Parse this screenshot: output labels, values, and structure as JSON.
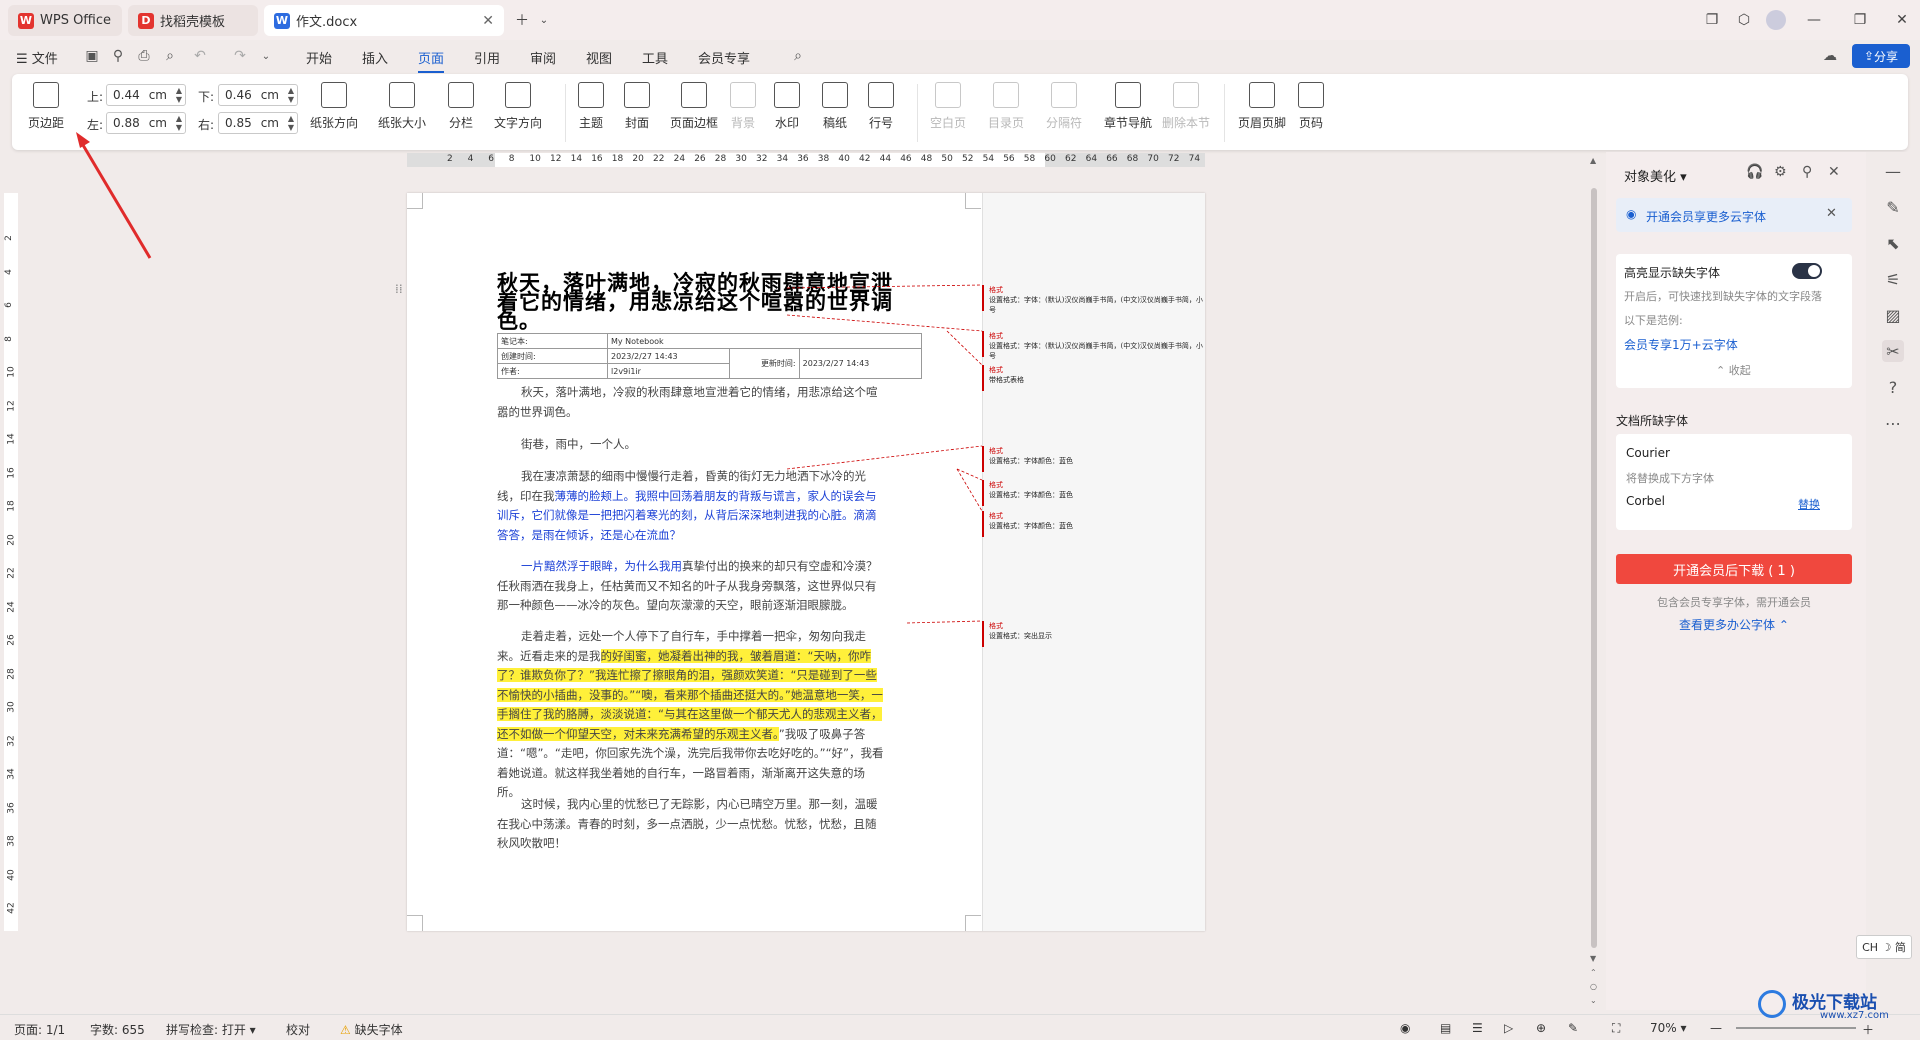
{
  "tabs": [
    {
      "label": "WPS Office",
      "icon": "wps-logo-icon"
    },
    {
      "label": "找稻壳模板",
      "icon": "docer-icon"
    },
    {
      "label": "作文.docx",
      "icon": "word-doc-icon"
    }
  ],
  "menu": {
    "file": "文件",
    "items": [
      "开始",
      "插入",
      "页面",
      "引用",
      "审阅",
      "视图",
      "工具",
      "会员专享"
    ],
    "selected": "页面",
    "share": "分享"
  },
  "ribbon": {
    "margins_label": "页边距",
    "top_label": "上:",
    "top_value": "0.44",
    "bottom_label": "下:",
    "bottom_value": "0.46",
    "left_label": "左:",
    "left_value": "0.88",
    "right_label": "右:",
    "right_value": "0.85",
    "unit": "cm",
    "buttons": [
      "纸张方向",
      "纸张大小",
      "分栏",
      "文字方向",
      "主题",
      "封面",
      "页面边框",
      "背景",
      "水印",
      "稿纸",
      "行号",
      "空白页",
      "目录页",
      "分隔符",
      "章节导航",
      "删除本节",
      "页眉页脚",
      "页码"
    ]
  },
  "ruler": {
    "h_numbers": [
      "2",
      "4",
      "6",
      "8",
      "10",
      "12",
      "14",
      "16",
      "18",
      "20",
      "22",
      "24",
      "26",
      "28",
      "30",
      "32",
      "34",
      "36",
      "38",
      "40",
      "42",
      "44",
      "46",
      "48",
      "50",
      "52",
      "54",
      "56",
      "58",
      "60",
      "62",
      "64",
      "66",
      "68",
      "70",
      "72",
      "74"
    ],
    "v_numbers": [
      "2",
      "4",
      "6",
      "8",
      "10",
      "12",
      "14",
      "16",
      "18",
      "20",
      "22",
      "24",
      "26",
      "28",
      "30",
      "32",
      "34",
      "36",
      "38",
      "40",
      "42"
    ]
  },
  "document": {
    "title": "秋天，落叶满地，冷寂的秋雨肆意地宣泄着它的情绪，用悲凉给这个喧嚣的世界调色。",
    "info": {
      "notebook_label": "笔记本:",
      "notebook_value": "My Notebook",
      "created_label": "创建时间:",
      "created_value": "2023/2/27 14:43",
      "updated_label": "更新时间:",
      "updated_value": "2023/2/27 14:43",
      "author_label": "作者:",
      "author_value": "l2v9i1ir"
    },
    "p1": "秋天，落叶满地，冷寂的秋雨肆意地宣泄着它的情绪，用悲凉给这个喧嚣的世界调色。",
    "p2": "街巷，雨中，一个人。",
    "p3a": "我在凄凉萧瑟的细雨中慢慢行走着，昏黄的街灯无力地洒下冰冷的光线，印在我",
    "p3b": "薄薄的脸颊上。我照中回荡着朋友的背叛与谎言，家人的误会与训斥，它们就像是一把把闪着寒光的刻，从背后深深地刺进我的心脏。滴滴答答，是雨在倾诉，还是心在流血？",
    "p4a": "一片黯然浮于眼眸，为什么我用",
    "p4b": "真挚付出的换来的却只有空虚和冷漠？任秋雨洒在我身上，任枯黄而又不知名的叶子从我身旁飘落，这世界似只有那一种颜色——冰冷的灰色。望向灰濛濛的天空，眼前逐渐泪眼朦胧。",
    "p5a": "走着走着，远处一个人停下了自行车，手中撑着一把伞，匆匆向我走来。近看走来的是我",
    "p5b": "的好闺蜜，她凝着出神的我，皱着眉道：“天呐，你咋了？谁欺负你了？”我连忙擦了擦眼角的泪，强颜欢笑道：“只是碰到了一些不愉快的小插曲，没事的。”“噢，看来那个插曲还挺大的。”她温意地一笑，一手搁住了我的胳膊，淡淡说道：“与其在这里做一个郁天尤人的悲观主义者，还不如做一个仰望天空，对未来充满希望的乐观主义者。",
    "p5c": "”我吸了吸鼻子答道：“嗯”。“走吧，你回家先洗个澡，洗完后我带你去吃好吃的。”“好”，我看着她说道。就这样我坐着她的自行车，一路冒着雨，渐渐离开这失意的场所。",
    "p6": "这时候，我内心里的忧愁已了无踪影，内心已晴空万里。那一刻，温暖在我心中荡漾。青春的时刻，多一点洒脱，少一点忧愁。忧愁，忧愁，且随秋风吹散吧！",
    "marks": [
      {
        "tag": "格式",
        "text": "设置格式：字体：(默认)汉仪尚巍手书简，(中文)汉仪尚巍手书简，小号"
      },
      {
        "tag": "格式",
        "text": "设置格式：字体：(默认)汉仪尚巍手书简，(中文)汉仪尚巍手书简，小号"
      },
      {
        "tag": "格式",
        "text": "带格式表格"
      },
      {
        "tag": "格式",
        "text": "设置格式：字体颜色：蓝色"
      },
      {
        "tag": "格式",
        "text": "设置格式：字体颜色：蓝色"
      },
      {
        "tag": "格式",
        "text": "设置格式：字体颜色：蓝色"
      },
      {
        "tag": "格式",
        "text": "设置格式：突出显示"
      }
    ]
  },
  "panel": {
    "title": "对象美化",
    "promo": "开通会员享更多云字体",
    "highlight_label": "高亮显示缺失字体",
    "highlight_desc": "开启后，可快速找到缺失字体的文字段落",
    "example_label": "以下是范例:",
    "example_value": "会员专享1万+云字体",
    "collapse": "收起",
    "missing_label": "文档所缺字体",
    "missing_font": "Courier",
    "replace_hint": "将替换成下方字体",
    "replace_font": "Corbel",
    "replace_btn": "替换",
    "download_btn": "开通会员后下载 ( 1 )",
    "download_desc": "包含会员专享字体，需开通会员",
    "more_link": "查看更多办公字体"
  },
  "status": {
    "page": "页面: 1/1",
    "words": "字数: 655",
    "spell": "拼写检查: 打开",
    "proof": "校对",
    "missing": "缺失字体",
    "zoom": "70%",
    "ime": "CH ☽ 简"
  },
  "watermark": "极光下载站",
  "watermark_url": "www.xz7.com",
  "colors": {
    "accent": "#1a5fd0",
    "arrow": "#e02b2b",
    "download": "#f0483e"
  }
}
